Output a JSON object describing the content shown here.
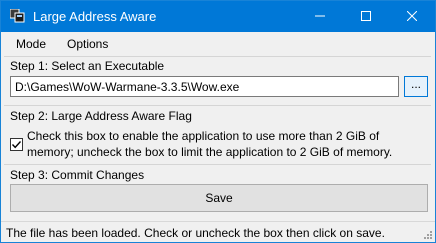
{
  "window": {
    "title": "Large Address Aware",
    "titlebar_color": "#0078d7"
  },
  "menu": {
    "items": [
      {
        "label": "Mode"
      },
      {
        "label": "Options"
      }
    ]
  },
  "step1": {
    "title": "Step 1: Select an Executable",
    "path_value": "D:\\Games\\WoW-Warmane-3.3.5\\Wow.exe",
    "browse_label": "..."
  },
  "step2": {
    "title": "Step 2: Large Address Aware Flag",
    "checkbox_checked": true,
    "checkbox_label": "Check this box to enable the application to use more than 2 GiB of memory; uncheck the box to limit the application to 2 GiB of memory."
  },
  "step3": {
    "title": "Step 3: Commit Changes",
    "save_label": "Save"
  },
  "status": {
    "text": "The file has been loaded.  Check or uncheck the box then click on save."
  },
  "icons": {
    "app": "app-icon",
    "minimize": "minimize-icon",
    "maximize": "maximize-icon",
    "close": "close-icon",
    "check": "checkmark-icon",
    "grip": "resize-grip-icon"
  }
}
